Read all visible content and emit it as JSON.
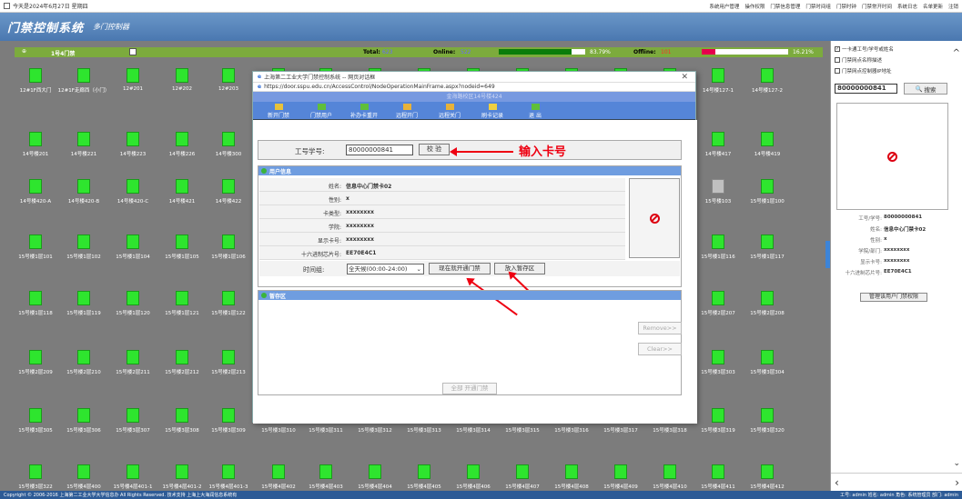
{
  "topbar": {
    "date": "今天是2024年6月27日 星期四",
    "links": [
      "系统用户管理",
      "操作权限",
      "门禁信息管理",
      "门禁时间组",
      "门禁时钟",
      "门禁常开时间",
      "系统日志",
      "名单更新",
      "注销"
    ]
  },
  "banner": {
    "title": "门禁控制系统",
    "subtitle": "多门控制器"
  },
  "statusbar": {
    "group": "1号4门禁",
    "total_label": "Total:",
    "total": "623",
    "online_label": "Online:",
    "online": "522",
    "online_pct": "83.79%",
    "online_fraction": 0.8379,
    "offline_label": "Offline:",
    "offline": "101",
    "offline_pct": "16.21%",
    "offline_fraction": 0.1621
  },
  "doors": {
    "rows": [
      [
        "12#1F西大门",
        "12#1F走廊西（小门）",
        "12#201",
        "12#202",
        "12#203",
        "",
        "",
        "",
        "",
        "",
        "",
        "",
        "",
        "",
        "14号楼127-1",
        "14号楼127-2"
      ],
      [
        "14号楼201",
        "14号楼221",
        "14号楼223",
        "14号楼226",
        "14号楼300",
        "",
        "",
        "",
        "",
        "",
        "",
        "",
        "",
        "",
        "14号楼417",
        "14号楼419"
      ],
      [
        "14号楼420-A",
        "14号楼420-B",
        "14号楼420-C",
        "14号楼421",
        "14号楼422",
        "",
        "",
        "",
        "",
        "",
        "",
        "",
        "",
        "",
        "15号楼103",
        "15号楼1层100"
      ],
      [
        "15号楼1层101",
        "15号楼1层102",
        "15号楼1层104",
        "15号楼1层105",
        "15号楼1层106",
        "",
        "",
        "",
        "",
        "",
        "",
        "",
        "",
        "",
        "15号楼1层116",
        "15号楼1层117"
      ],
      [
        "15号楼1层118",
        "15号楼1层119",
        "15号楼1层120",
        "15号楼1层121",
        "15号楼1层122",
        "",
        "",
        "",
        "",
        "",
        "",
        "",
        "",
        "",
        "15号楼2层207",
        "15号楼2层208"
      ],
      [
        "15号楼2层209",
        "15号楼2层210",
        "15号楼2层211",
        "15号楼2层212",
        "15号楼2层213",
        "",
        "",
        "",
        "",
        "",
        "",
        "",
        "",
        "",
        "15号楼3层303",
        "15号楼3层304"
      ],
      [
        "15号楼3层305",
        "15号楼3层306",
        "15号楼3层307",
        "15号楼3层308",
        "15号楼3层309",
        "15号楼3层310",
        "15号楼3层311",
        "15号楼3层312",
        "15号楼3层313",
        "15号楼3层314",
        "15号楼3层315",
        "15号楼3层316",
        "15号楼3层317",
        "15号楼3层318",
        "15号楼3层319",
        "15号楼3层320"
      ],
      [
        "15号楼3层322",
        "15号楼4层400",
        "15号楼4层401-1",
        "15号楼4层401-2",
        "15号楼4层401-3",
        "15号楼4层402",
        "15号楼4层403",
        "15号楼4层404",
        "15号楼4层405",
        "15号楼4层406",
        "15号楼4层407",
        "15号楼4层408",
        "15号楼4层409",
        "15号楼4层410",
        "15号楼4层411",
        "15号楼4层412"
      ]
    ],
    "offline_door": "15号楼103"
  },
  "footer": {
    "copyright": "Copyright © 2006-2016 上海第二工业大学大学信息办 All Rights Reserved.  技术支持 上海上大海润信息系统有",
    "right": "工号: admin  姓名: admin  角色: 系统管理员  部门: admin"
  },
  "right_panel": {
    "checks": [
      {
        "label": "一卡通工号/学号或姓名",
        "checked": true
      },
      {
        "label": "门禁网点名称描述",
        "checked": false
      },
      {
        "label": "门禁网点控制器IP地址",
        "checked": false
      }
    ],
    "search_value": "80000000841",
    "search_button": "搜索",
    "info": [
      {
        "k": "工号/学号:",
        "v": "80000000841"
      },
      {
        "k": "姓名:",
        "v": "信息中心门禁卡02"
      },
      {
        "k": "性别:",
        "v": "x"
      },
      {
        "k": "学院/部门:",
        "v": "xxxxxxxx"
      },
      {
        "k": "显示卡号:",
        "v": "xxxxxxxx"
      },
      {
        "k": "十六进制芯片号:",
        "v": "EE70E4C1"
      }
    ],
    "perm_button": "管理该用户门禁权限"
  },
  "dialog": {
    "title": "上海第二工业大学门禁控制系统 -- 网页对话框",
    "url": "https://door.sspu.edu.cn/AccessControl/NodeOperationMainFrame.aspx?nodeid=649",
    "header": "金海路校区14号楼424",
    "toolbar": [
      "新开门禁",
      "门禁用户",
      "补办卡重开",
      "远程开门",
      "远程关门",
      "刷卡记录",
      "退 出"
    ],
    "id_label": "工号学号:",
    "id_value": "80000000841",
    "check_button": "校 验",
    "annotation": "输入卡号",
    "userinfo_title": "用户信息",
    "userinfo": [
      {
        "k": "姓名:",
        "v": "信息中心门禁卡02"
      },
      {
        "k": "性别:",
        "v": "x"
      },
      {
        "k": "卡类型:",
        "v": "xxxxxxxx"
      },
      {
        "k": "学院:",
        "v": "xxxxxxxx"
      },
      {
        "k": "显示卡号:",
        "v": "xxxxxxxx"
      },
      {
        "k": "十六进制芯片号:",
        "v": "EE70E4C1"
      }
    ],
    "time_label": "时间组:",
    "time_value": "全天候(00:00-24:00)",
    "open_now_button": "现在就开通门禁",
    "temp_button": "放入暂存区",
    "temp_title": "暂存区",
    "remove_button": "Remove>>",
    "clear_button": "Clear>>",
    "all_open_button": "全部 开通门禁"
  }
}
